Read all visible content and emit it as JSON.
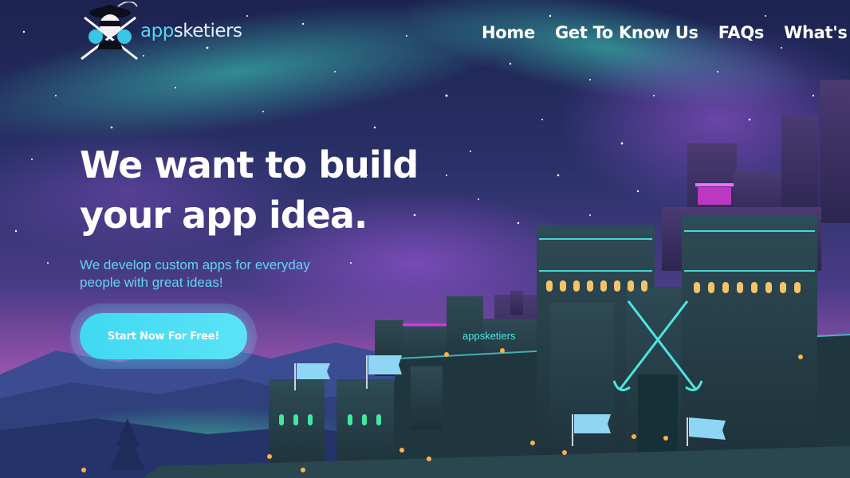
{
  "brand": {
    "name_prefix": "app",
    "name_suffix": "sketiers",
    "logo_icon": "masked-musketeer-crossed-swords-icon"
  },
  "nav": {
    "items": [
      "Home",
      "Get To Know Us",
      "FAQs",
      "What's"
    ]
  },
  "hero": {
    "title_line1": "We want to build",
    "title_line2": "your app idea.",
    "subtitle_line1": "We develop custom apps for everyday",
    "subtitle_line2": "people with great ideas!",
    "cta_label": "Start Now For Free!",
    "castle_sign_text": "appsketiers"
  },
  "colors": {
    "accent": "#4fd8f0",
    "subtitle": "#63d3f3",
    "sky_top": "#1d2552",
    "neon_pink": "#d43bd4",
    "neon_teal": "#4be6e2"
  }
}
